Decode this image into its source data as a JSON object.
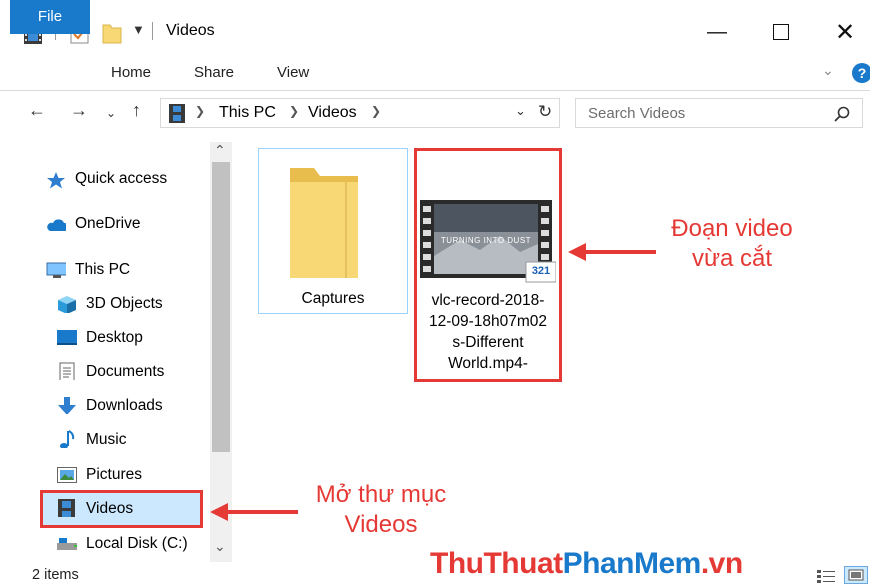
{
  "window": {
    "title": "Videos",
    "controls": [
      "minimize",
      "maximize",
      "close"
    ]
  },
  "ribbon": {
    "tabs": [
      "File",
      "Home",
      "Share",
      "View"
    ]
  },
  "address": {
    "segments": [
      "This PC",
      "Videos"
    ],
    "search_placeholder": "Search Videos"
  },
  "sidebar": {
    "items": [
      {
        "label": "Quick access",
        "icon": "star-icon"
      },
      {
        "label": "OneDrive",
        "icon": "cloud-icon"
      },
      {
        "label": "This PC",
        "icon": "computer-icon"
      },
      {
        "label": "3D Objects",
        "icon": "cube-icon"
      },
      {
        "label": "Desktop",
        "icon": "desktop-icon"
      },
      {
        "label": "Documents",
        "icon": "document-icon"
      },
      {
        "label": "Downloads",
        "icon": "download-arrow-icon"
      },
      {
        "label": "Music",
        "icon": "music-note-icon"
      },
      {
        "label": "Pictures",
        "icon": "picture-icon"
      },
      {
        "label": "Videos",
        "icon": "film-icon",
        "selected": true
      },
      {
        "label": "Local Disk (C:)",
        "icon": "disk-icon"
      }
    ]
  },
  "content": {
    "items": [
      {
        "name": "Captures",
        "type": "folder"
      },
      {
        "name": "vlc-record-2018-12-09-18h07m02s-Different World.mp4-",
        "type": "video",
        "name_lines": [
          "vlc-record-2018-",
          "12-09-18h07m02",
          "s-Different",
          "World.mp4-"
        ],
        "thumbnail_text": "TURNING INTO DUST",
        "badge": "321"
      }
    ]
  },
  "annotations": {
    "video_note": [
      "Đoạn video",
      "vừa cắt"
    ],
    "folder_note": [
      "Mở thư mục",
      "Videos"
    ]
  },
  "watermark": {
    "part1": "ThuThuat",
    "part2": "PhanMem",
    "part3": ".vn"
  },
  "status": {
    "count": "2 items"
  },
  "colors": {
    "accent": "#1979ca",
    "annotation": "#e53935",
    "selection": "#cce8ff",
    "folder": "#f8d775"
  }
}
